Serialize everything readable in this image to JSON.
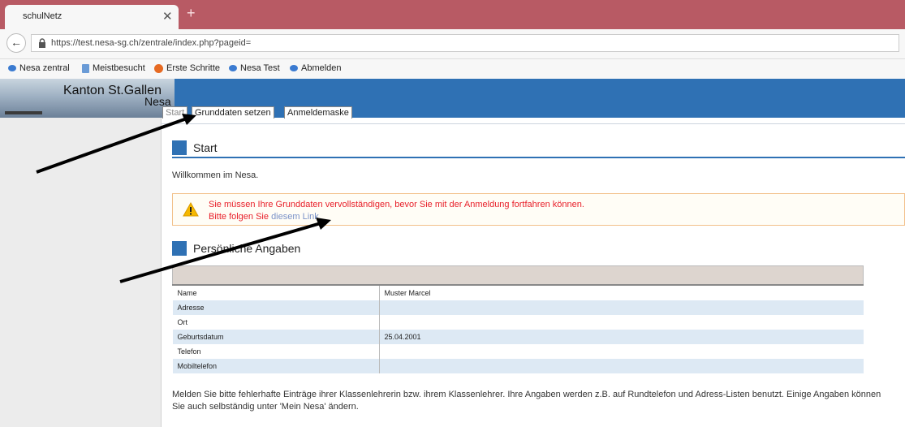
{
  "browser": {
    "tab_title": "schulNetz",
    "close_glyph": "✕",
    "new_tab_glyph": "+",
    "back_glyph": "←",
    "url": "https://test.nesa-sg.ch/zentrale/index.php?pageid=",
    "bookmarks": [
      {
        "label": "Nesa zentral",
        "icon": "cloud-icon"
      },
      {
        "label": "Meistbesucht",
        "icon": "document-icon"
      },
      {
        "label": "Erste Schritte",
        "icon": "firefox-icon"
      },
      {
        "label": "Nesa Test",
        "icon": "cloud-icon"
      },
      {
        "label": "Abmelden",
        "icon": "cloud-icon"
      }
    ]
  },
  "site": {
    "title": "Kanton St.Gallen",
    "subtitle": "Nesa",
    "tabs": [
      {
        "label": "Start"
      },
      {
        "label": "Grunddaten setzen"
      },
      {
        "label": "Anmeldemaske"
      }
    ]
  },
  "start": {
    "heading": "Start",
    "welcome": "Willkommen im Nesa.",
    "alert_line1": "Sie müssen Ihre Grunddaten vervollständigen, bevor Sie mit der Anmeldung fortfahren können.",
    "alert_line2_prefix": "Bitte folgen Sie ",
    "alert_link": "diesem Link"
  },
  "personal": {
    "heading": "Persönliche Angaben",
    "rows": [
      {
        "label": "Name",
        "value": "Muster Marcel"
      },
      {
        "label": "Adresse",
        "value": ""
      },
      {
        "label": "Ort",
        "value": ""
      },
      {
        "label": "Geburtsdatum",
        "value": "25.04.2001"
      },
      {
        "label": "Telefon",
        "value": ""
      },
      {
        "label": "Mobiltelefon",
        "value": ""
      }
    ],
    "note": "Melden Sie bitte fehlerhafte Einträge ihrer Klassenlehrerin bzw. ihrem Klassenlehrer. Ihre Angaben werden z.B. auf Rundtelefon und Adress-Listen benutzt. Einige Angaben können Sie auch selbständig unter 'Mein Nesa' ändern."
  },
  "colors": {
    "header_blue": "#2f71b4",
    "tabbar": "#b85a64",
    "alert_red": "#e8202a",
    "alert_border": "#f2c08a",
    "row_alt": "#dde9f4"
  }
}
